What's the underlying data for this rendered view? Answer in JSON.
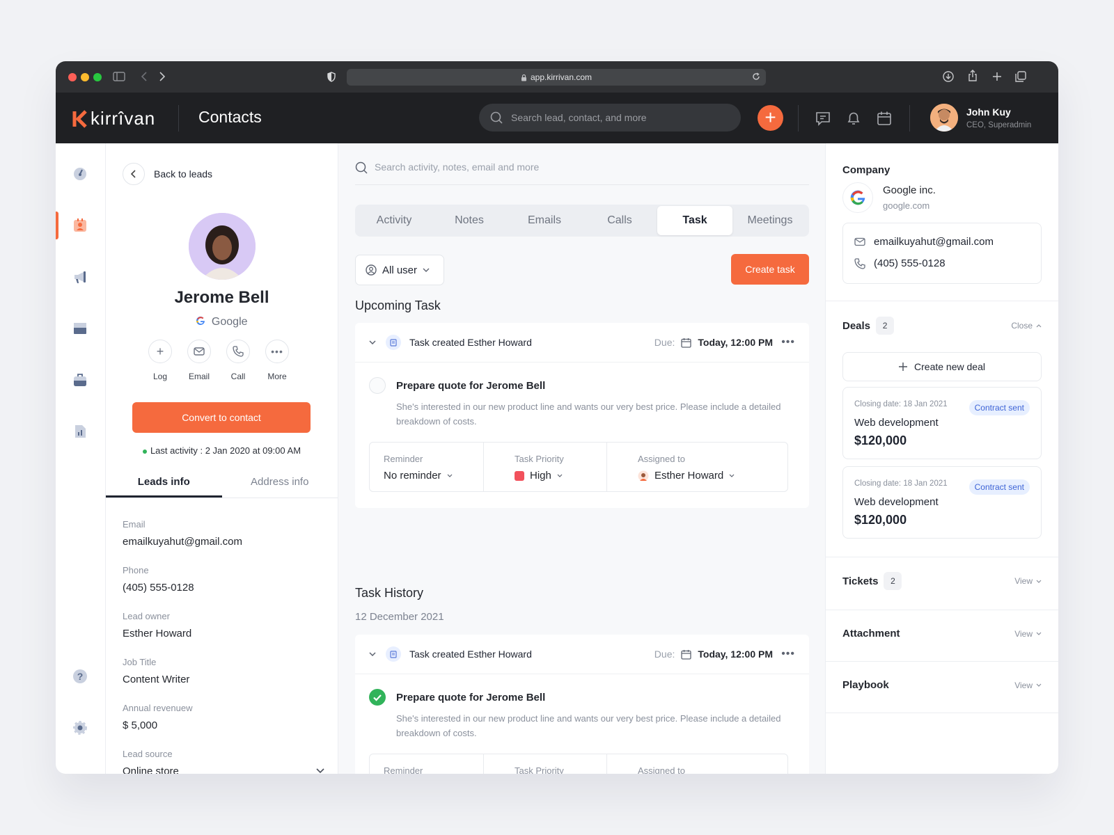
{
  "browser": {
    "url": "app.kirrivan.com"
  },
  "header": {
    "brand": "kirrîvan",
    "title": "Contacts",
    "search_placeholder": "Search lead, contact, and more",
    "user": {
      "name": "John Kuy",
      "role": "CEO, Superadmin"
    }
  },
  "left": {
    "back_label": "Back to leads",
    "name": "Jerome Bell",
    "company": "Google",
    "actions": [
      "Log",
      "Email",
      "Call",
      "More"
    ],
    "convert_label": "Convert to contact",
    "last_activity": "Last activity : 2 Jan 2020 at 09:00 AM",
    "tabs": [
      "Leads info",
      "Address info"
    ],
    "fields": [
      {
        "label": "Email",
        "value": "emailkuyahut@gmail.com"
      },
      {
        "label": "Phone",
        "value": "(405) 555-0128"
      },
      {
        "label": "Lead owner",
        "value": "Esther Howard"
      },
      {
        "label": "Job Title",
        "value": "Content Writer"
      },
      {
        "label": "Annual revenuew",
        "value": "$ 5,000"
      },
      {
        "label": "Lead source",
        "value": "Online store"
      }
    ]
  },
  "center": {
    "search_placeholder": "Search activity, notes, email and more",
    "tabs": [
      "Activity",
      "Notes",
      "Emails",
      "Calls",
      "Task",
      "Meetings"
    ],
    "filter": "All user",
    "create_label": "Create task",
    "upcoming_title": "Upcoming Task",
    "history_title": "Task History",
    "history_date": "12 December 2021",
    "task": {
      "created_prefix": "Task created",
      "created_by": "Esther Howard",
      "due_label": "Due:",
      "due_value": "Today, 12:00 PM",
      "title": "Prepare quote for Jerome Bell",
      "desc": "She's interested in our new product line and wants our very best price. Please include a detailed breakdown of costs.",
      "reminder_label": "Reminder",
      "reminder_value": "No reminder",
      "priority_label": "Task Priority",
      "priority_value": "High",
      "assigned_label": "Assigned to",
      "assigned_value": "Esther Howard"
    }
  },
  "right": {
    "company_title": "Company",
    "company_name": "Google inc.",
    "company_domain": "google.com",
    "email": "emailkuyahut@gmail.com",
    "phone": "(405) 555-0128",
    "deals_title": "Deals",
    "deals_count": "2",
    "deals_toggle": "Close",
    "create_deal": "Create new deal",
    "deals": [
      {
        "closing": "Closing date: 18 Jan 2021",
        "status": "Contract sent",
        "name": "Web development",
        "amount": "$120,000"
      },
      {
        "closing": "Closing date: 18 Jan 2021",
        "status": "Contract sent",
        "name": "Web development",
        "amount": "$120,000"
      }
    ],
    "tickets_title": "Tickets",
    "tickets_count": "2",
    "attachment_title": "Attachment",
    "playbook_title": "Playbook",
    "view_label": "View"
  },
  "colors": {
    "accent": "#f56a3e",
    "dark": "#1f2023",
    "priority_high": "#f2515c",
    "success": "#31b35a"
  }
}
